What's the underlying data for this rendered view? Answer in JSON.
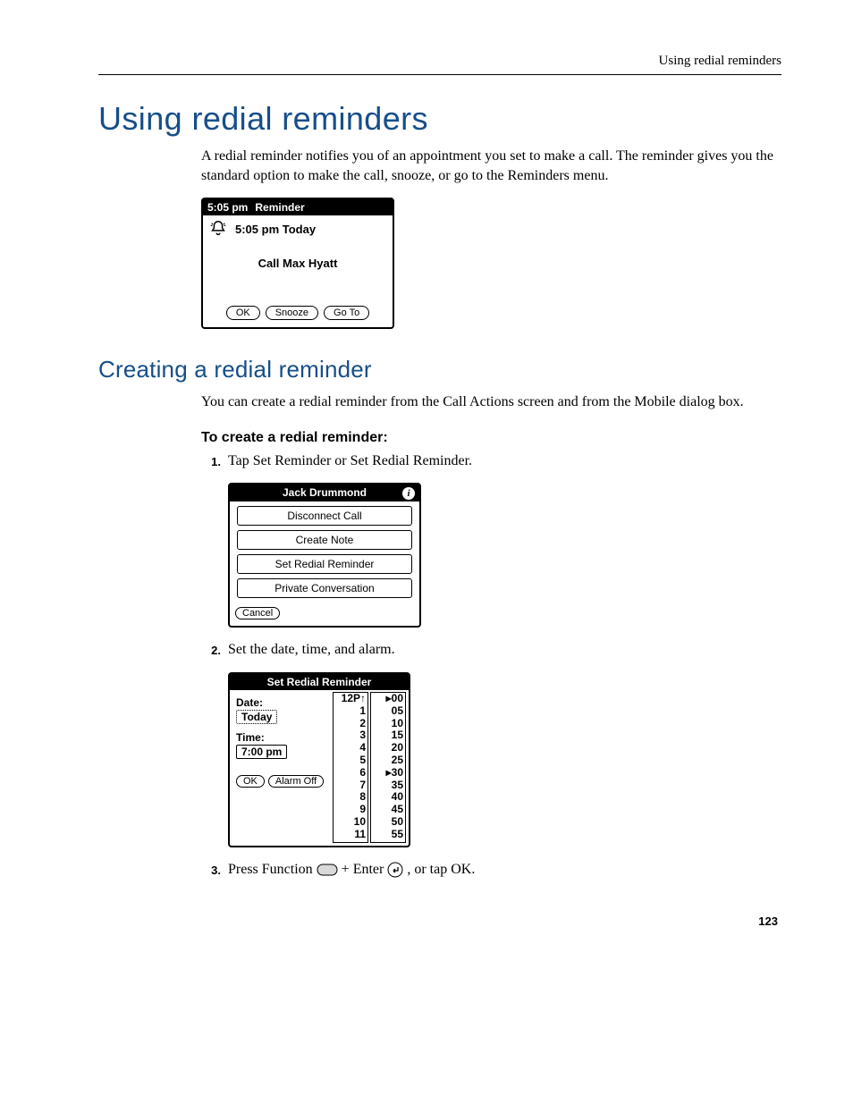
{
  "header": {
    "running_head": "Using redial reminders"
  },
  "h1": "Using redial reminders",
  "intro": "A redial reminder notifies you of an appointment you set to make a call. The reminder gives you the standard option to make the call, snooze, or go to the Reminders menu.",
  "palm_reminder": {
    "titlebar_time": "5:05 pm",
    "titlebar_label": "Reminder",
    "bell_text": "5:05 pm Today",
    "message": "Call Max Hyatt",
    "buttons": {
      "ok": "OK",
      "snooze": "Snooze",
      "goto": "Go To"
    }
  },
  "h2": "Creating a redial reminder",
  "p2": "You can create a redial reminder from the Call Actions screen and from the Mobile dialog box.",
  "h3": "To create a redial reminder:",
  "steps": {
    "s1": "Tap Set Reminder or Set Redial Reminder.",
    "s2": "Set the date, time, and alarm.",
    "s3_a": "Press Function ",
    "s3_b": " + Enter ",
    "s3_c": ", or tap OK."
  },
  "palm_actions": {
    "title": "Jack Drummond",
    "items": {
      "disconnect": "Disconnect Call",
      "note": "Create Note",
      "set_redial": "Set Redial Reminder",
      "private": "Private Conversation"
    },
    "cancel": "Cancel"
  },
  "palm_srr": {
    "title": "Set Redial Reminder",
    "date_label": "Date:",
    "date_value": "Today",
    "time_label": "Time:",
    "time_value": "7:00 pm",
    "ok": "OK",
    "alarm_off": "Alarm Off",
    "hours_header": "12P",
    "hours": "1\n2\n3\n4\n5\n6\n7\n8\n9\n10\n11",
    "mins": "00\n05\n10\n15\n20\n25\n30\n35\n40\n45\n50\n55",
    "hour_mark": "▸",
    "min_mark": "▸"
  },
  "icons": {
    "bell": "bell-icon",
    "info": "i",
    "function_key": "function-key-icon",
    "enter_key": "enter-key-icon",
    "up_arrow": "↑"
  },
  "footer": {
    "page_number": "123"
  }
}
